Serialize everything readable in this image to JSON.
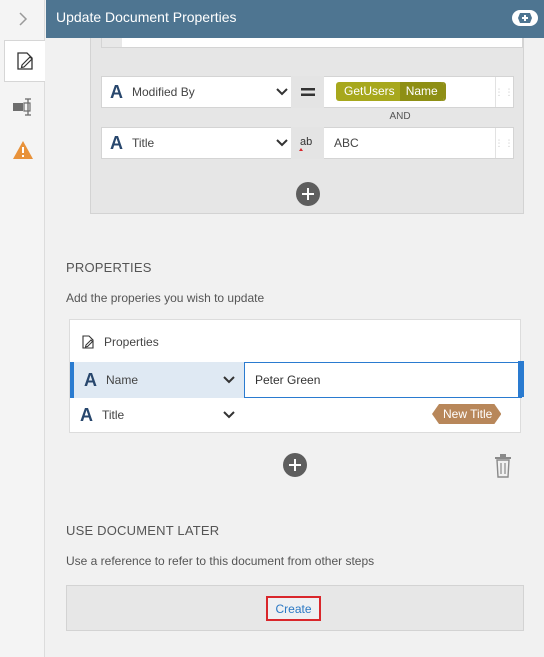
{
  "header": {
    "title": "Update Document Properties"
  },
  "conditions": {
    "rows": [
      {
        "field": "Modified By",
        "operator_icon": "equals-icon",
        "value_token": {
          "source": "GetUsers",
          "property": "Name"
        }
      },
      {
        "field": "Title",
        "operator_icon": "text-contains-icon",
        "value": "ABC"
      }
    ],
    "joiner": "AND"
  },
  "properties": {
    "title": "PROPERTIES",
    "description": "Add the properies you wish to update",
    "card_title": "Properties",
    "rows": [
      {
        "field": "Name",
        "value": "Peter Green"
      },
      {
        "field": "Title",
        "value_token": "New Title"
      }
    ]
  },
  "use_later": {
    "title": "USE DOCUMENT LATER",
    "description": "Use a reference to refer to this document from other steps",
    "create_label": "Create"
  },
  "colors": {
    "header": "#4e7591",
    "accent_blue": "#2a7bd0",
    "token_olive": "#a7a81d",
    "token_brown": "#b8875a",
    "warning": "#e8923a",
    "highlight_red": "#d9262b"
  }
}
